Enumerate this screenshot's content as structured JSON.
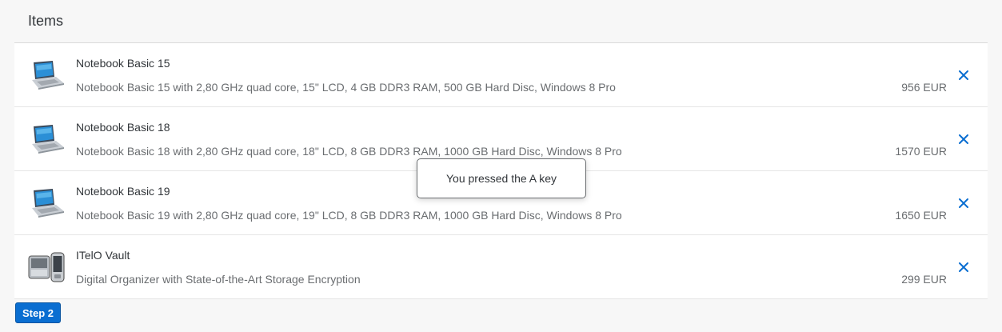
{
  "panel": {
    "title": "Items"
  },
  "items": [
    {
      "icon": "laptop-icon",
      "title": "Notebook Basic 15",
      "description": "Notebook Basic 15 with 2,80 GHz quad core, 15\" LCD, 4 GB DDR3 RAM, 500 GB Hard Disc, Windows 8 Pro",
      "price": "956 EUR"
    },
    {
      "icon": "laptop-icon",
      "title": "Notebook Basic 18",
      "description": "Notebook Basic 18 with 2,80 GHz quad core, 18\" LCD, 8 GB DDR3 RAM, 1000 GB Hard Disc, Windows 8 Pro",
      "price": "1570 EUR"
    },
    {
      "icon": "laptop-icon",
      "title": "Notebook Basic 19",
      "description": "Notebook Basic 19 with 2,80 GHz quad core, 19\" LCD, 8 GB DDR3 RAM, 1000 GB Hard Disc, Windows 8 Pro",
      "price": "1650 EUR"
    },
    {
      "icon": "organizer-device-icon",
      "title": "ITelO Vault",
      "description": "Digital Organizer with State-of-the-Art Storage Encryption",
      "price": "299 EUR"
    }
  ],
  "delete_icon": "close-x-icon",
  "step": {
    "label": "Step 2"
  },
  "toast": {
    "message": "You pressed the A key"
  },
  "colors": {
    "accent": "#0a6ed1",
    "text": "#32363a",
    "secondary_text": "#6a6d70",
    "background": "#f7f7f7"
  }
}
